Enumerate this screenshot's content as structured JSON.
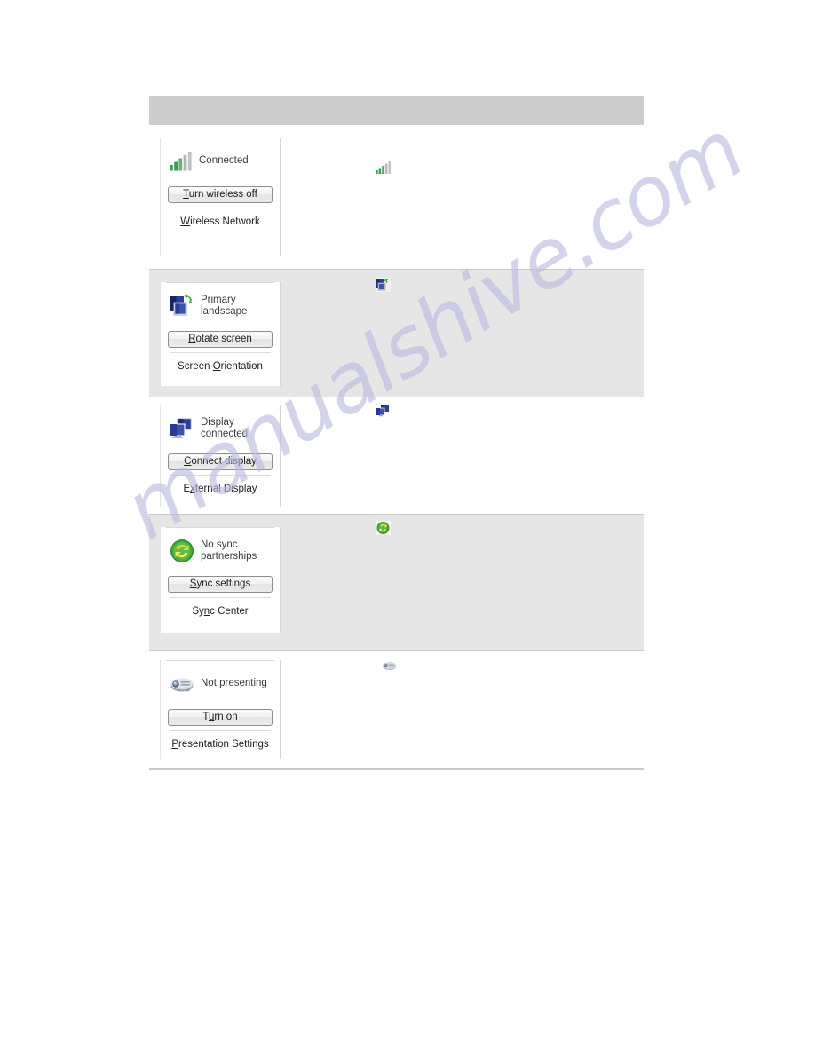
{
  "page": {
    "watermark_text": "manualshive.com",
    "banner": {
      "label": ""
    }
  },
  "tiles": [
    {
      "id": "wireless-network",
      "icon": "wireless-signal-icon",
      "status": "Connected",
      "button": {
        "label": "Turn wireless off",
        "accel": "T"
      },
      "link": {
        "label": "Wireless Network",
        "accel": "W"
      },
      "shaded": false
    },
    {
      "id": "screen-orientation",
      "icon": "screen-rotate-icon",
      "status": "Primary\nlandscape",
      "button": {
        "label": "Rotate screen",
        "accel": "R"
      },
      "link": {
        "label": "Screen Orientation",
        "accel": "O"
      },
      "shaded": true
    },
    {
      "id": "external-display",
      "icon": "dual-monitor-icon",
      "status": "Display\nconnected",
      "button": {
        "label": "Connect display",
        "accel": "C"
      },
      "link": {
        "label": "External Display",
        "accel": "x"
      },
      "shaded": false
    },
    {
      "id": "sync-center",
      "icon": "sync-arrows-icon",
      "status": "No sync\npartnerships",
      "button": {
        "label": "Sync settings",
        "accel": "S"
      },
      "link": {
        "label": "Sync Center",
        "accel": "n"
      },
      "shaded": true
    },
    {
      "id": "presentation-settings",
      "icon": "projector-icon",
      "status": "Not presenting",
      "button": {
        "label": "Turn on",
        "accel": "u"
      },
      "link": {
        "label": "Presentation Settings",
        "accel": "P"
      },
      "shaded": false
    }
  ],
  "colors": {
    "banner_gray": "#cdcdcd",
    "row_shaded": "#e6e6e6",
    "signal_green": "#3f9b53",
    "signal_gray": "#b8b8b8",
    "monitor_blue": "#2a3f97",
    "sync_green": "#3aa03a",
    "sync_yellow": "#c9d93a",
    "projector_gray": "#9aa0a8",
    "text": "#3b3b3b"
  }
}
